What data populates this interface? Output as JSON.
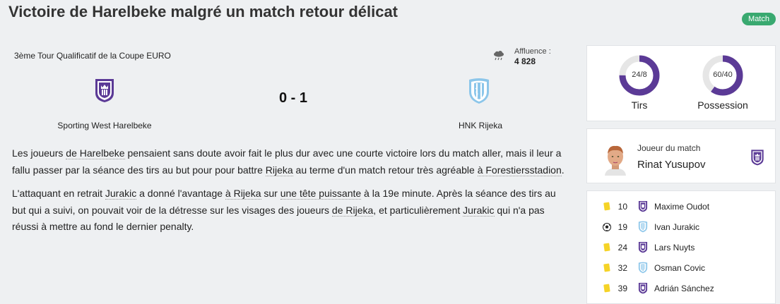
{
  "headline": "Victoire de Harelbeke malgré un match retour délicat",
  "tag": "Match",
  "match": {
    "competition": "3ème Tour Qualificatif de la Coupe EURO",
    "attendance_label": "Affluence :",
    "attendance_value": "4 828",
    "weather_icon": "cloud-rain-icon",
    "score": "0 - 1",
    "home_team": "Sporting West Harelbeke",
    "away_team": "HNK Rijeka"
  },
  "report": {
    "p1": {
      "t1": "Les joueurs ",
      "l1": "de Harelbeke",
      "t2": " pensaient sans doute avoir fait le plus dur avec une courte victoire lors du match aller, mais il leur a fallu passer par la séance des tirs au but pour pour battre ",
      "l2": "Rijeka",
      "t3": " au terme d'un match retour très agréable ",
      "l3": "à Forestiersstadion",
      "t4": "."
    },
    "p2": {
      "t1": "L'attaquant en retrait ",
      "l1": "Jurakic",
      "t2": " a donné l'avantage ",
      "l2": "à Rijeka",
      "t3": " sur ",
      "l3": "une tête puissante",
      "t4": " à la 19e minute. Après la séance des tirs au but qui a suivi, on pouvait voir de la détresse sur les visages des joueurs ",
      "l4": "de Rijeka",
      "t5": ", et particulièrement ",
      "l5": "Jurakic",
      "t6": " qui n'a pas réussi à mettre au fond le dernier penalty."
    }
  },
  "stats": [
    {
      "label": "Tirs",
      "value_text": "24/8",
      "home_share": 0.75
    },
    {
      "label": "Possession",
      "value_text": "60/40",
      "home_share": 0.6
    }
  ],
  "colors": {
    "home": "#5b3a96",
    "away": "#8cc6ea",
    "ring_track": "#e6e6e6",
    "tag": "#39a970"
  },
  "motm": {
    "label": "Joueur du match",
    "name": "Rinat Yusupov"
  },
  "events": [
    {
      "icon": "yellow-card-icon",
      "minute": "10",
      "team": "home",
      "player": "Maxime Oudot"
    },
    {
      "icon": "ball-icon",
      "minute": "19",
      "team": "away",
      "player": "Ivan Jurakic"
    },
    {
      "icon": "yellow-card-icon",
      "minute": "24",
      "team": "home",
      "player": "Lars Nuyts"
    },
    {
      "icon": "yellow-card-icon",
      "minute": "32",
      "team": "away",
      "player": "Osman Covic"
    },
    {
      "icon": "yellow-card-icon",
      "minute": "39",
      "team": "home",
      "player": "Adrián Sánchez"
    }
  ]
}
